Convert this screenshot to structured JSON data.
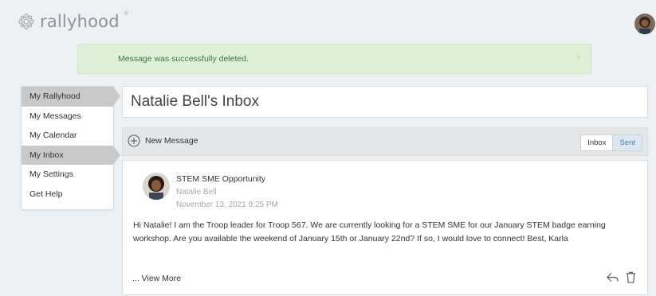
{
  "app": {
    "logo_text": "rallyhood",
    "logo_tm": "®"
  },
  "alert": {
    "message": "Message was successfully deleted.",
    "close": "×"
  },
  "sidebar": {
    "items": [
      {
        "label": "My Rallyhood",
        "active": true
      },
      {
        "label": "My Messages",
        "active": false
      },
      {
        "label": "My Calendar",
        "active": false
      },
      {
        "label": "My Inbox",
        "active": true
      },
      {
        "label": "My Settings",
        "active": false
      },
      {
        "label": "Get Help",
        "active": false
      }
    ]
  },
  "inbox": {
    "title": "Natalie Bell's Inbox",
    "new_message_label": "New Message",
    "tabs": {
      "inbox": "Inbox",
      "sent": "Sent",
      "selected": "Sent"
    }
  },
  "message": {
    "subject": "STEM SME Opportunity",
    "sender": "Natalie Bell",
    "date": "November 13, 2021 9:25 PM",
    "body": "Hi Natalie! I am the Troop leader for Troop 567. We are currently looking for a STEM SME for our January STEM badge earning workshop. Are you available the weekend of January 15th or January 22nd? If so, I would love to connect! Best, Karla",
    "view_more": "... View More",
    "icons": [
      "reply-icon",
      "trash-icon"
    ]
  },
  "colors": {
    "alert_bg": "#dff0d8",
    "alert_text": "#3c763d",
    "active_nav": "#c9c9c9",
    "sent_tab": "#dbe7f2",
    "muted_text": "#a8a8a8"
  }
}
